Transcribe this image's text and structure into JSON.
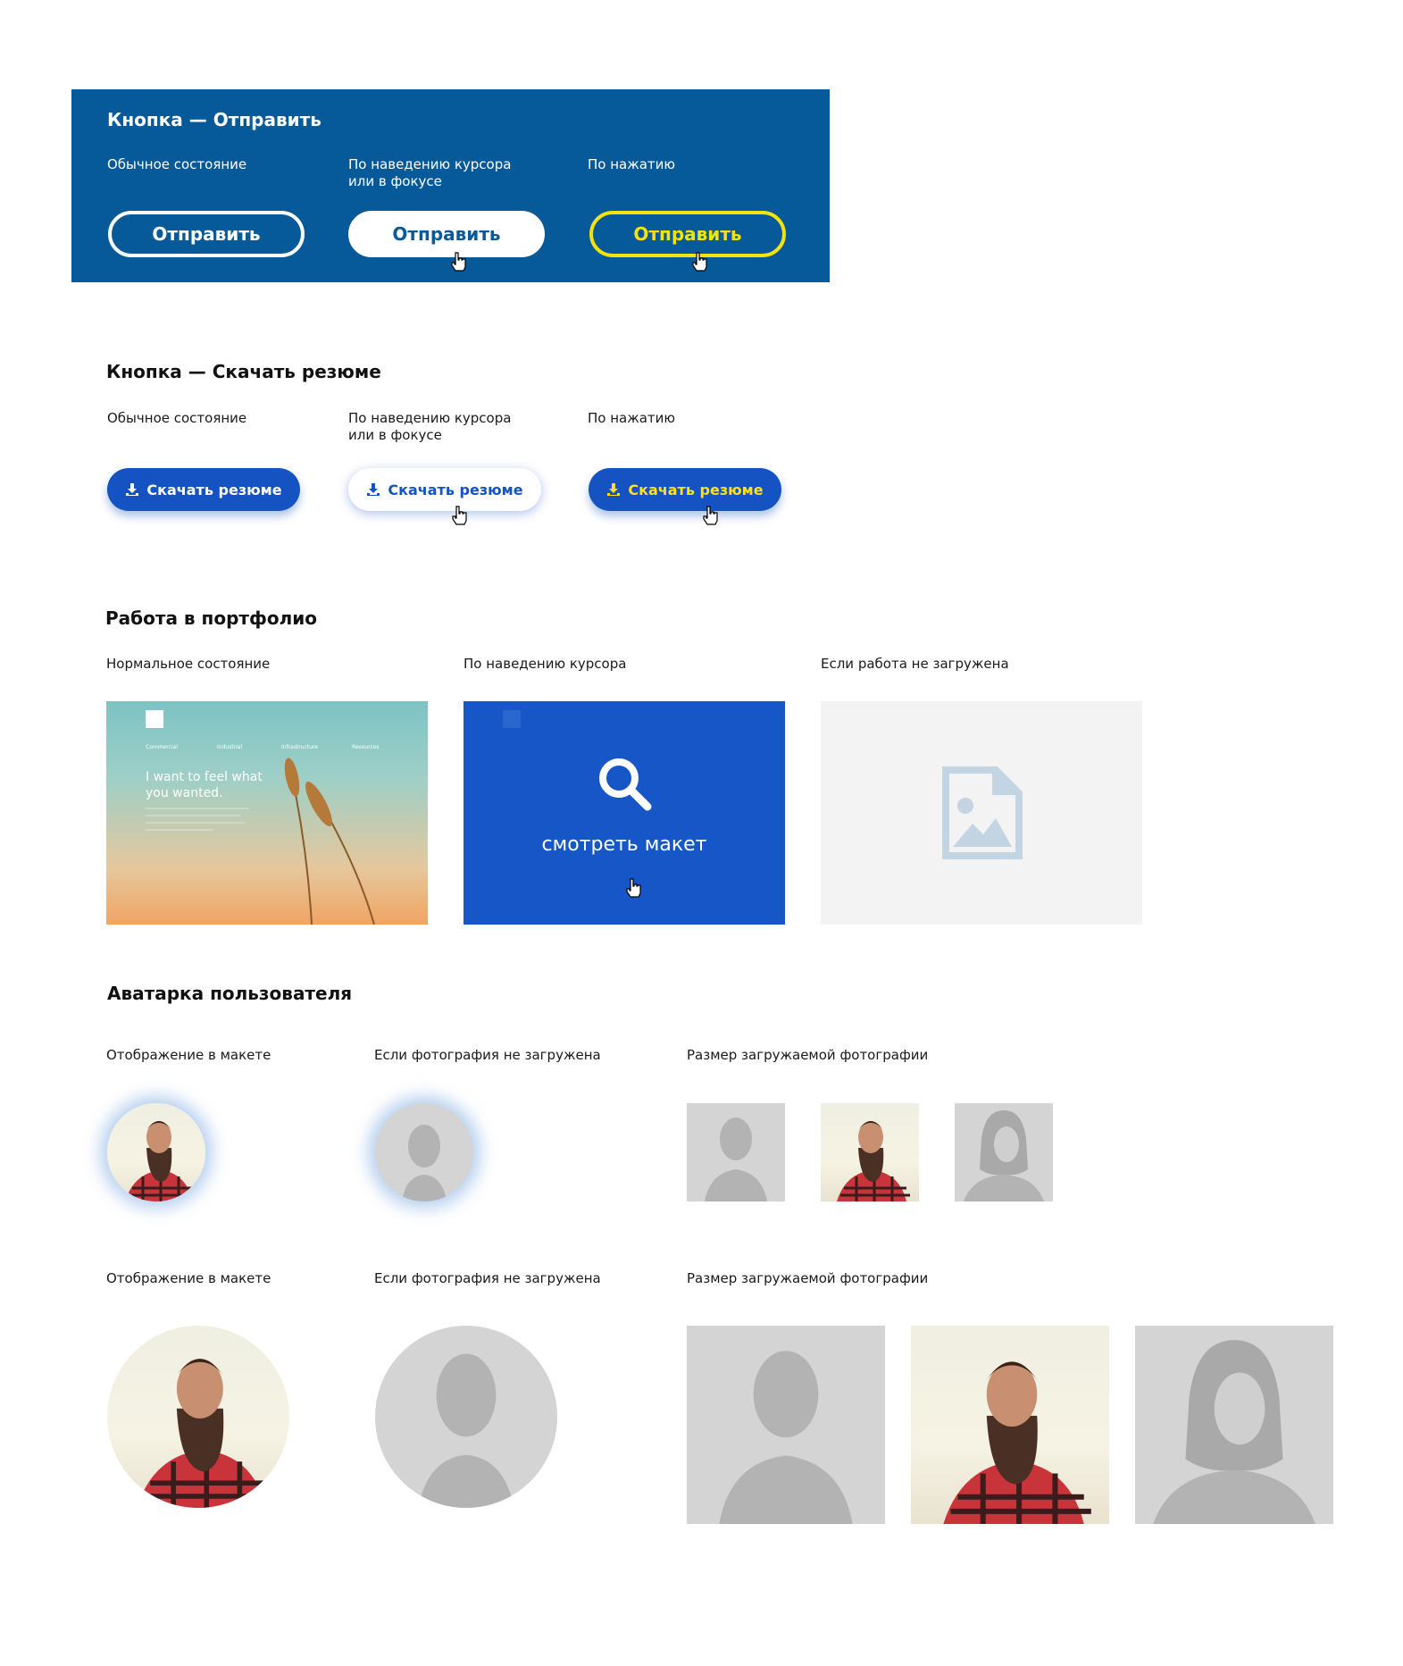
{
  "send_section": {
    "title": "Кнопка — Отправить",
    "states": [
      {
        "label": "Обычное состояние",
        "button": "Отправить"
      },
      {
        "label": "По наведению курсора\nили в фокусе",
        "button": "Отправить"
      },
      {
        "label": "По нажатию",
        "button": "Отправить"
      }
    ]
  },
  "resume_section": {
    "title": "Кнопка — Скачать резюме",
    "states": [
      {
        "label": "Обычное состояние",
        "button": "Скачать резюме"
      },
      {
        "label": "По наведению курсора\nили в фокусе",
        "button": "Скачать резюме"
      },
      {
        "label": "По нажатию",
        "button": "Скачать резюме"
      }
    ]
  },
  "portfolio_section": {
    "title": "Работа в портфолио",
    "states": [
      {
        "label": "Нормальное состояние"
      },
      {
        "label": "По наведению курсора"
      },
      {
        "label": "Если работа не загружена"
      }
    ],
    "preview": {
      "nav": [
        "Commercial",
        "Industrial",
        "Infrastructure",
        "Resources"
      ],
      "headline": "I want to feel what\nyou wanted."
    },
    "hover_text": "смотреть макет"
  },
  "avatar_section": {
    "title": "Аватарка пользователя",
    "row1": [
      {
        "label": "Отображение в макете"
      },
      {
        "label": "Если фотография не загружена"
      },
      {
        "label": "Размер загружаемой фотографии"
      }
    ],
    "row2": [
      {
        "label": "Отображение в макете"
      },
      {
        "label": "Если фотография не загружена"
      },
      {
        "label": "Размер загружаемой фотографии"
      }
    ]
  },
  "colors": {
    "panel_blue": "#075a99",
    "button_blue": "#1453c1",
    "accent_yellow": "#f4e20c"
  },
  "icons": [
    "cursor-hand-icon",
    "download-icon",
    "search-icon",
    "image-placeholder-icon",
    "male-silhouette-icon",
    "female-silhouette-icon"
  ]
}
